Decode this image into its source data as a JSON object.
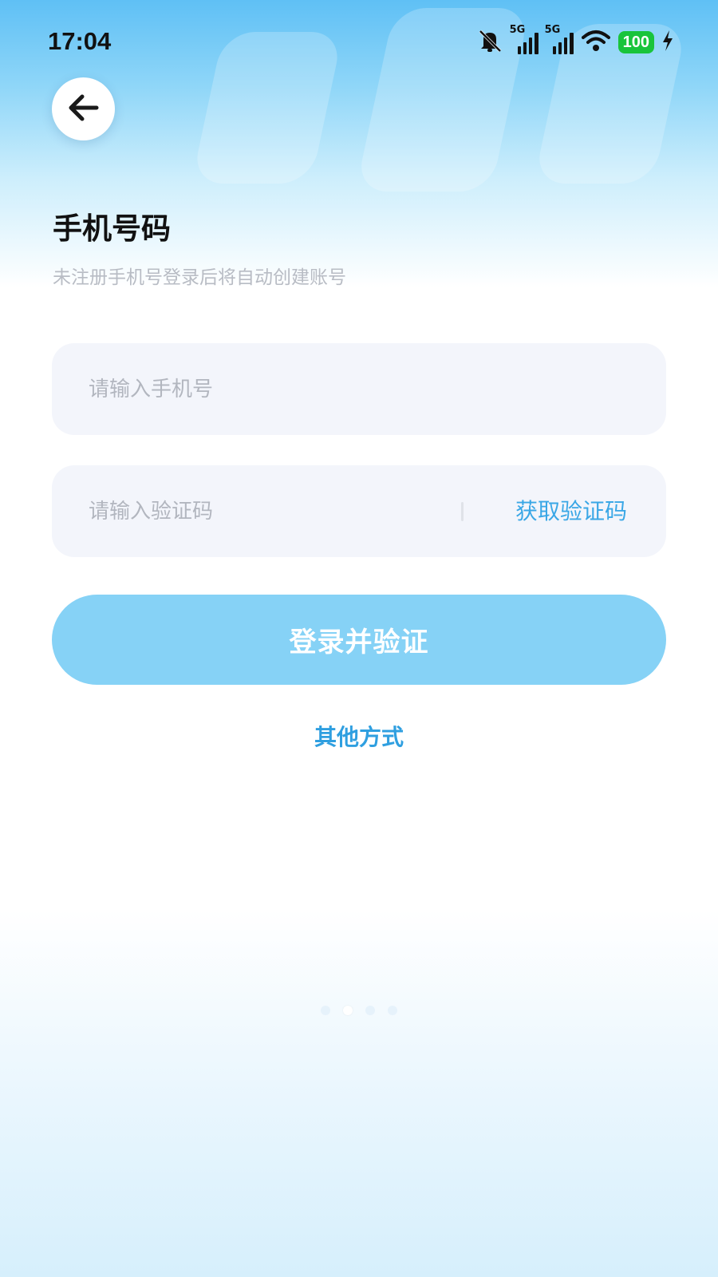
{
  "status_bar": {
    "time": "17:04",
    "network_1": "5G",
    "network_2": "5G",
    "battery": "100",
    "icons": [
      "mute-bell-icon",
      "signal-icon",
      "signal-icon",
      "wifi-icon",
      "battery-icon",
      "charging-bolt-icon"
    ]
  },
  "header": {
    "back_icon": "arrow-left-icon"
  },
  "main": {
    "title": "手机号码",
    "subtitle": "未注册手机号登录后将自动创建账号",
    "phone_field": {
      "value": "",
      "placeholder": "请输入手机号"
    },
    "code_field": {
      "value": "",
      "placeholder": "请输入验证码"
    },
    "get_code_label": "获取验证码",
    "login_button_label": "登录并验证",
    "other_methods_label": "其他方式"
  },
  "pager": {
    "count": 4,
    "active_index": 1
  },
  "colors": {
    "accent": "#3aa7e6",
    "button": "#86d2f6",
    "field_bg": "#f3f5fb",
    "battery": "#19c43b"
  }
}
